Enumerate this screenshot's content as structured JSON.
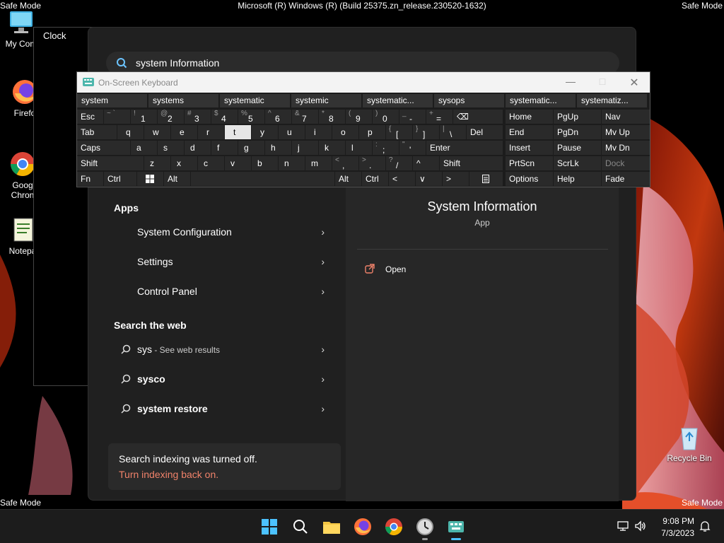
{
  "titlebar": {
    "text": "Microsoft (R) Windows (R) (Build 25375.zn_release.230520-1632)"
  },
  "safemode_text": "Safe Mode",
  "desktop": {
    "icons": [
      {
        "label": "My Com",
        "icon": "computer-icon"
      },
      {
        "label": "Firefo",
        "icon": "firefox-icon"
      },
      {
        "label": "Goog Chron",
        "icon": "chrome-icon"
      },
      {
        "label": "Notepa",
        "icon": "notepad-icon"
      },
      {
        "label": "Recycle Bin",
        "icon": "recycle-bin-icon"
      }
    ]
  },
  "clock_window": {
    "title": "Clock"
  },
  "search": {
    "query": "system Information",
    "sections": {
      "apps": "Apps",
      "web": "Search the web"
    },
    "apps": [
      {
        "label": "System Configuration"
      },
      {
        "label": "Settings"
      },
      {
        "label": "Control Panel"
      }
    ],
    "web": [
      {
        "label": "sys",
        "suffix": " - See web results"
      },
      {
        "label": "sysco",
        "suffix": ""
      },
      {
        "label": "system restore",
        "suffix": ""
      }
    ],
    "indexing": {
      "message": "Search indexing was turned off.",
      "link": "Turn indexing back on."
    },
    "preview": {
      "title": "System Information",
      "subtitle": "App",
      "open_label": "Open"
    }
  },
  "osk": {
    "title": "On-Screen Keyboard",
    "predictions": [
      "system",
      "systems",
      "systematic",
      "systemic",
      "systematic...",
      "sysops",
      "systematic...",
      "systematiz..."
    ],
    "row1": {
      "esc": "Esc",
      "keys": [
        {
          "s": "~ `",
          "b": ""
        },
        {
          "s": "!",
          "b": "1"
        },
        {
          "s": "@",
          "b": "2"
        },
        {
          "s": "#",
          "b": "3"
        },
        {
          "s": "$",
          "b": "4"
        },
        {
          "s": "%",
          "b": "5"
        },
        {
          "s": "^",
          "b": "6"
        },
        {
          "s": "&",
          "b": "7"
        },
        {
          "s": "*",
          "b": "8"
        },
        {
          "s": "(",
          "b": "9"
        },
        {
          "s": ")",
          "b": "0"
        },
        {
          "s": "_",
          "b": "-"
        },
        {
          "s": "+",
          "b": "="
        }
      ],
      "backspace": "⌫"
    },
    "row2": {
      "tab": "Tab",
      "letters": [
        "q",
        "w",
        "e",
        "r",
        "t",
        "y",
        "u",
        "i",
        "o",
        "p"
      ],
      "brackets": [
        {
          "s": "{",
          "b": "["
        },
        {
          "s": "}",
          "b": "]"
        },
        {
          "s": "|",
          "b": "\\"
        }
      ],
      "del": "Del"
    },
    "row3": {
      "caps": "Caps",
      "letters": [
        "a",
        "s",
        "d",
        "f",
        "g",
        "h",
        "j",
        "k",
        "l"
      ],
      "punct": [
        {
          "s": ":",
          "b": ";"
        },
        {
          "s": "\"",
          "b": "'"
        }
      ],
      "enter": "Enter"
    },
    "row4": {
      "shift": "Shift",
      "letters": [
        "z",
        "x",
        "c",
        "v",
        "b",
        "n",
        "m"
      ],
      "punct": [
        {
          "s": "<",
          "b": ","
        },
        {
          "s": ">",
          "b": "."
        },
        {
          "s": "?",
          "b": "/"
        }
      ],
      "up": "^",
      "shift_r": "Shift"
    },
    "row5": {
      "fn": "Fn",
      "ctrl": "Ctrl",
      "alt": "Alt",
      "alt_r": "Alt",
      "ctrl_r": "Ctrl",
      "left": "<",
      "down": "∨",
      "right": ">"
    },
    "nav": [
      [
        "Home",
        "PgUp",
        "Nav"
      ],
      [
        "End",
        "PgDn",
        "Mv Up"
      ],
      [
        "Insert",
        "Pause",
        "Mv Dn"
      ],
      [
        "PrtScn",
        "ScrLk",
        "Dock"
      ],
      [
        "Options",
        "Help",
        "Fade"
      ]
    ]
  },
  "taskbar": {
    "time": "9:08 PM",
    "date": "7/3/2023"
  },
  "colors": {
    "accent_link": "#f0826a",
    "panel_bg": "#202020",
    "preview_bg": "#272727",
    "osk_key": "#2a2a2a"
  }
}
